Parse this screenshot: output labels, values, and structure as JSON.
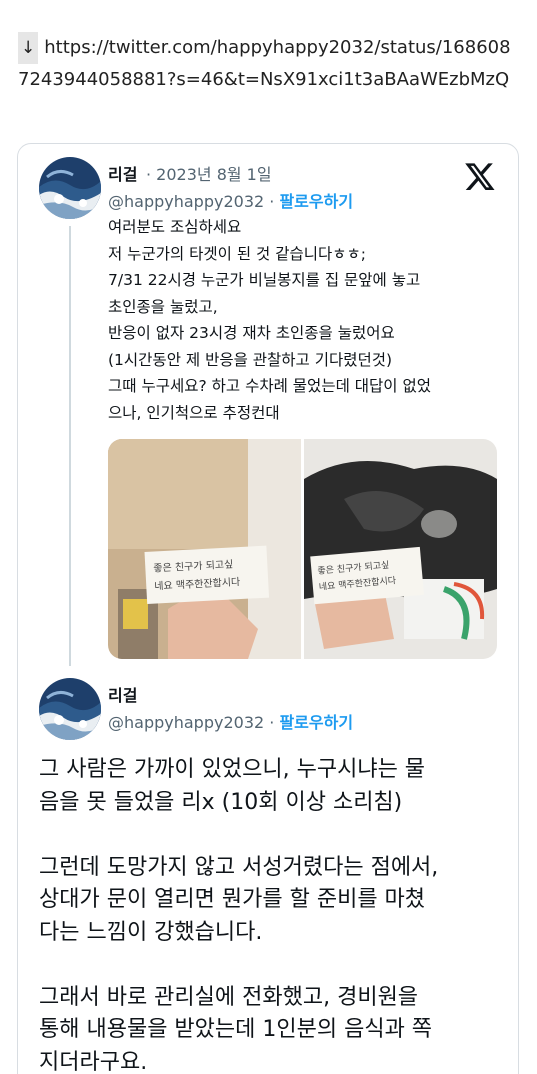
{
  "link": {
    "arrow": "↓",
    "url": "https://twitter.com/happyhappy2032/status/1686087243944058881?s=46&t=NsX91xci1t3aBAaWEzbMzQ"
  },
  "tweet1": {
    "name": "리걸",
    "date": "· 2023년 8월 1일",
    "handle": "@happyhappy2032",
    "dot": "·",
    "follow": "팔로우하기",
    "lines": [
      "여러분도 조심하세요",
      "저 누군가의 타겟이 된 것 같습니다ㅎㅎ;",
      "7/31 22시경 누군가 비닐봉지를 집 문앞에 놓고",
      "초인종을 눌렀고,",
      "반응이 없자 23시경 재차 초인종을 눌렀어요",
      "(1시간동안 제 반응을 관찰하고 기다렸던것)",
      "그때 누구세요? 하고 수차례 물었는데 대답이 없었",
      "으나, 인기척으로 추정컨대"
    ],
    "photo_note_line1": "좋은 친구가 되고싶",
    "photo_note_line2": "네요 맥주한잔합시다"
  },
  "tweet2": {
    "name": "리걸",
    "handle": "@happyhappy2032",
    "dot": "·",
    "follow": "팔로우하기",
    "lines": [
      "그 사람은 가까이 있었으니, 누구시냐는 물",
      "음을 못 들었을 리x (10회 이상 소리침)",
      "",
      "그런데 도망가지 않고 서성거렸다는 점에서,",
      "상대가 문이 열리면 뭔가를 할 준비를 마쳤",
      "다는 느낌이 강했습니다.",
      "",
      "그래서 바로 관리실에 전화했고, 경비원을",
      "통해 내용물을 받았는데 1인분의 음식과 쪽",
      "지더라구요."
    ]
  },
  "colors": {
    "link_blue": "#1d9bf0",
    "muted": "#536471",
    "border": "#d8dde2"
  }
}
